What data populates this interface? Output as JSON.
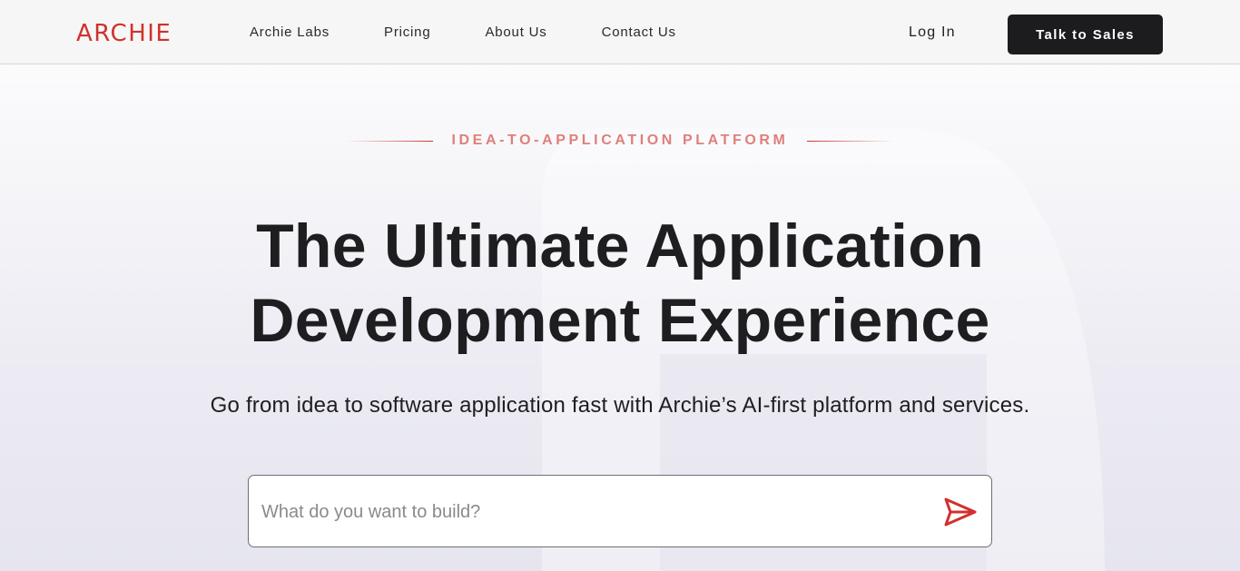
{
  "header": {
    "logo": "ARCHIE",
    "nav": [
      {
        "label": "Archie Labs"
      },
      {
        "label": "Pricing"
      },
      {
        "label": "About Us"
      },
      {
        "label": "Contact Us"
      }
    ],
    "login_label": "Log In",
    "cta_label": "Talk to Sales"
  },
  "hero": {
    "eyebrow": "IDEA-TO-APPLICATION PLATFORM",
    "title_line1": "The Ultimate Application",
    "title_line2": "Development Experience",
    "subtitle": "Go from idea to software application fast with Archie’s AI-first platform and services."
  },
  "prompt": {
    "value": "",
    "placeholder": "What do you want to build?"
  },
  "icons": {
    "send": "send-arrow-icon"
  },
  "colors": {
    "brand_red": "#d0312d",
    "cta_bg": "#1c1c1f",
    "text_dark": "#1e1e20",
    "eyebrow": "#e07f7b"
  }
}
